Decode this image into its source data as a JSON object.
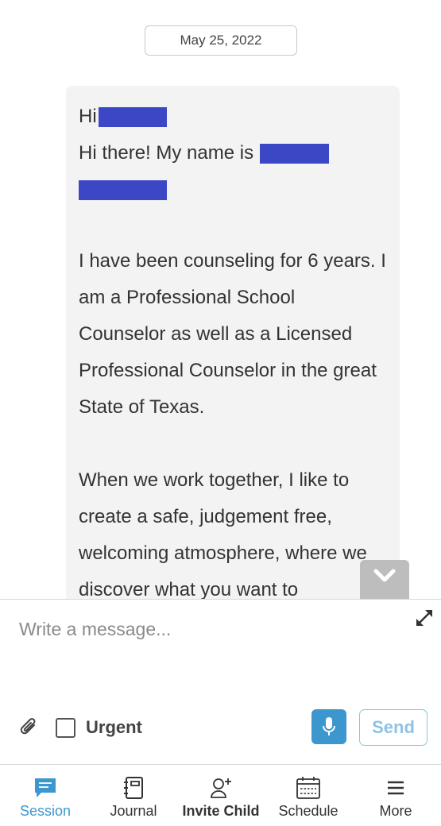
{
  "conversation": {
    "date": "May 25, 2022",
    "message": {
      "greeting_1": "Hi",
      "greeting_2": "Hi there! My name is",
      "paragraph_1": "I have been counseling for 6 years. I am a Professional School Counselor as well as a Licensed Professional Counselor in the great State of Texas.",
      "paragraph_2": "When we work together, I like to create a safe, judgement free, welcoming atmosphere, where we discover what you want to"
    }
  },
  "composer": {
    "placeholder": "Write a message...",
    "urgent_label": "Urgent",
    "urgent_checked": false,
    "send_label": "Send"
  },
  "nav": {
    "items": [
      {
        "label": "Session",
        "icon": "chat-bubble-icon",
        "active": true
      },
      {
        "label": "Journal",
        "icon": "journal-icon",
        "active": false
      },
      {
        "label": "Invite Child",
        "icon": "add-person-icon",
        "active": false
      },
      {
        "label": "Schedule",
        "icon": "calendar-icon",
        "active": false
      },
      {
        "label": "More",
        "icon": "menu-icon",
        "active": false
      }
    ]
  },
  "colors": {
    "accent": "#3d97cf",
    "send_text": "#8ec3e3",
    "bubble_bg": "#f3f3f3",
    "redaction": "#3b47c4",
    "scroll_button": "#bdbdbd"
  }
}
